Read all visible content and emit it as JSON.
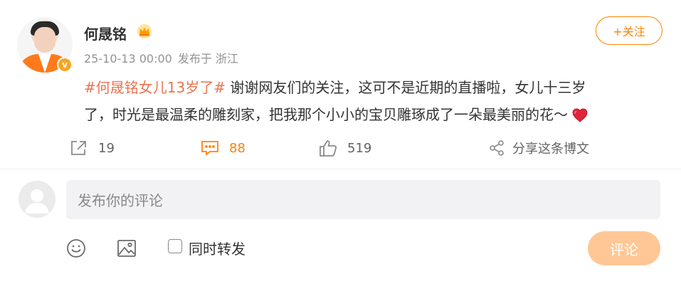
{
  "post": {
    "author": "何晟铭",
    "timestamp": "25-10-13 00:00",
    "source": "发布于 浙江",
    "follow_label": "+关注",
    "hashtag": "#何晟铭女儿13岁了#",
    "text_line1": "谢谢网友们的关注，这可不是近期的直播啦，女儿十三岁",
    "text_line2": "了，时光是最温柔的雕刻家，把我那个小小的宝贝雕琢成了一朵最美丽的花～"
  },
  "actions": {
    "reposts": "19",
    "comments": "88",
    "likes": "519",
    "share": "分享这条博文"
  },
  "comment_box": {
    "placeholder": "发布你的评论",
    "repost_label": "同时转发",
    "submit_label": "评论"
  },
  "colors": {
    "accent": "#ff8200",
    "hashtag": "#eb7350",
    "verified_badge": "#f7a623",
    "submit_disabled": "#ffc795"
  },
  "icons": [
    "crown-icon",
    "verified-badge-icon",
    "repost-icon",
    "comment-icon",
    "like-icon",
    "share-icon",
    "emoji-icon",
    "image-icon",
    "heart-emoji-icon"
  ]
}
